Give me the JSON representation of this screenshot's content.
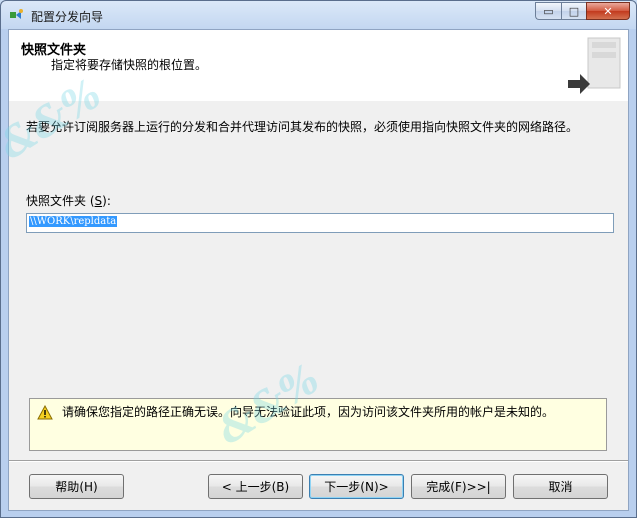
{
  "window": {
    "title": "配置分发向导",
    "controls": {
      "minimize": "▭",
      "maximize": "□",
      "close": "✕"
    }
  },
  "header": {
    "title": "快照文件夹",
    "subtitle": "指定将要存储快照的根位置。"
  },
  "body": {
    "intro": "若要允许订阅服务器上运行的分发和合并代理访问其发布的快照，必须使用指向快照文件夹的网络路径。",
    "field_label": "快照文件夹",
    "field_label_accel_prefix": " (",
    "field_label_accel": "S",
    "field_label_accel_suffix": "):",
    "path_value": "\\\\WORK\\repldata",
    "warning_text": "请确保您指定的路径正确无误。向导无法验证此项，因为访问该文件夹所用的帐户是未知的。"
  },
  "buttons": {
    "help": "帮助",
    "help_accel": "(H)",
    "back": "< 上一步",
    "back_accel": "(B)",
    "next": "下一步",
    "next_accel": "(N)",
    "next_suffix": " >",
    "finish": "完成",
    "finish_accel": "(F)",
    "finish_suffix": " >>|",
    "cancel": "取消"
  },
  "watermark_text": "&&%"
}
